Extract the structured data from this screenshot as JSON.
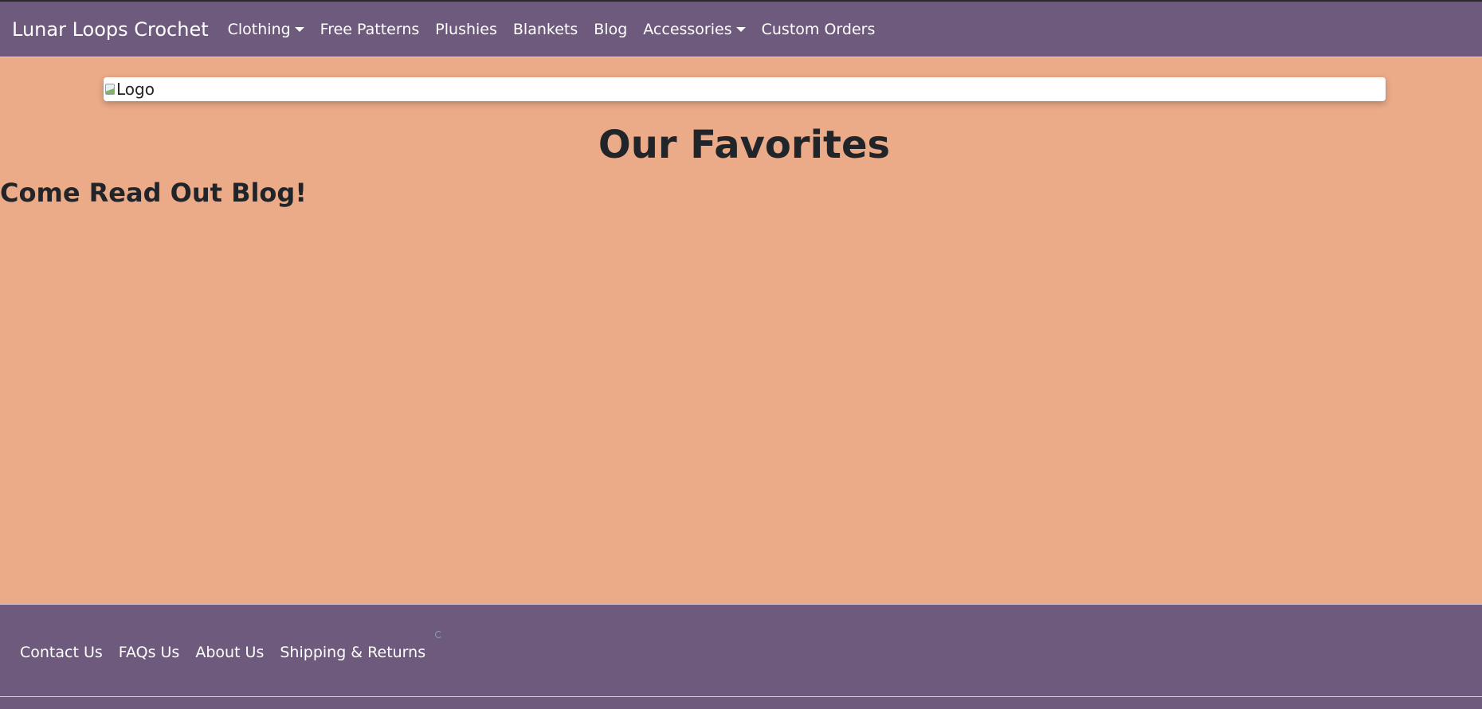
{
  "navbar": {
    "brand": "Lunar Loops Crochet",
    "items": [
      {
        "label": "Clothing",
        "dropdown": true
      },
      {
        "label": "Free Patterns",
        "dropdown": false
      },
      {
        "label": "Plushies",
        "dropdown": false
      },
      {
        "label": "Blankets",
        "dropdown": false
      },
      {
        "label": "Blog",
        "dropdown": false
      },
      {
        "label": "Accessories",
        "dropdown": true
      },
      {
        "label": "Custom Orders",
        "dropdown": false
      }
    ]
  },
  "logo": {
    "alt": "Logo"
  },
  "main": {
    "title": "Our Favorites",
    "blog_heading": "Come Read Out Blog!"
  },
  "footer": {
    "links": [
      "Contact Us",
      "FAQs Us",
      "About Us",
      "Shipping & Returns"
    ]
  },
  "colors": {
    "page_background": "#EBAA88",
    "nav_background": "#6D5A7C",
    "text_dark": "#212529",
    "text_light": "#FFFFFF"
  }
}
